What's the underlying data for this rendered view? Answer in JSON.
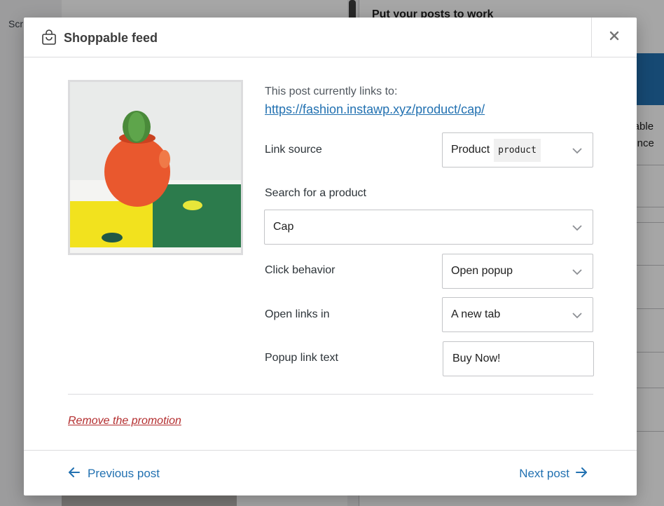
{
  "background": {
    "left_snippet": "Scr",
    "right_title": "Put your posts to work",
    "right_text_1": "opable",
    "right_text_2": "erence"
  },
  "modal": {
    "title": "Shoppable feed",
    "close_label": "×",
    "currently_links_label": "This post currently links to:",
    "current_link": "https://fashion.instawp.xyz/product/cap/",
    "link_source": {
      "label": "Link source",
      "value": "Product",
      "tag": "product"
    },
    "search": {
      "label": "Search for a product",
      "value": "Cap"
    },
    "click_behavior": {
      "label": "Click behavior",
      "value": "Open popup"
    },
    "open_links_in": {
      "label": "Open links in",
      "value": "A new tab"
    },
    "popup_link_text": {
      "label": "Popup link text",
      "value": "Buy Now!"
    },
    "remove_label": "Remove the promotion",
    "footer": {
      "prev_label": "Previous post",
      "next_label": "Next post"
    }
  },
  "colors": {
    "accent": "#2271b1",
    "danger": "#b32d2e",
    "header_blue": "#2271b1"
  },
  "icons": [
    "shopping-bag-icon",
    "close-icon",
    "chevron-down-icon",
    "arrow-left-icon",
    "arrow-right-icon"
  ]
}
